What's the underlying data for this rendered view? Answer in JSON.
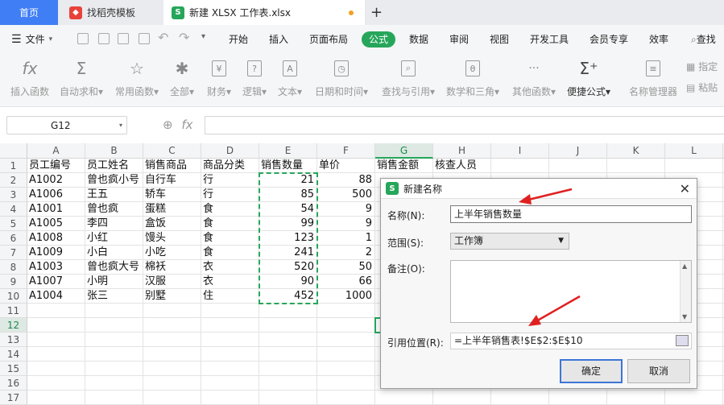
{
  "tabs": {
    "home": "首页",
    "template": "找稻壳模板",
    "file": "新建 XLSX 工作表.xlsx",
    "add": "+"
  },
  "menu": {
    "file": "文件",
    "items": [
      "开始",
      "插入",
      "页面布局",
      "公式",
      "数据",
      "审阅",
      "视图",
      "开发工具",
      "会员专享",
      "效率"
    ],
    "active": "公式",
    "search": "查找"
  },
  "ribbon": {
    "buttons": [
      "插入函数",
      "自动求和",
      "常用函数",
      "全部",
      "财务",
      "逻辑",
      "文本",
      "日期和时间",
      "查找与引用",
      "数学和三角",
      "其他函数",
      "便捷公式",
      "名称管理器"
    ],
    "right_top": "指定",
    "right_bottom": "粘贴"
  },
  "formula_bar": {
    "cell_ref": "G12",
    "fx": "fx",
    "content": ""
  },
  "grid": {
    "columns": [
      "A",
      "B",
      "C",
      "D",
      "E",
      "F",
      "G",
      "H",
      "I",
      "J",
      "K",
      "L"
    ],
    "rows": [
      "1",
      "2",
      "3",
      "4",
      "5",
      "6",
      "7",
      "8",
      "9",
      "10",
      "11",
      "12",
      "13",
      "14",
      "15",
      "16",
      "17"
    ],
    "header": [
      "员工编号",
      "员工姓名",
      "销售商品",
      "商品分类",
      "销售数量",
      "单价",
      "销售金额",
      "核查人员"
    ],
    "data": [
      [
        "A1002",
        "曾也疯小号",
        "自行车",
        "行",
        "21",
        "88"
      ],
      [
        "A1006",
        "王五",
        "轿车",
        "行",
        "85",
        "500"
      ],
      [
        "A1001",
        "曾也疯",
        "蛋糕",
        "食",
        "54",
        "9"
      ],
      [
        "A1005",
        "李四",
        "盒饭",
        "食",
        "99",
        "9"
      ],
      [
        "A1008",
        "小红",
        "馒头",
        "食",
        "123",
        "1"
      ],
      [
        "A1009",
        "小白",
        "小吃",
        "食",
        "241",
        "2"
      ],
      [
        "A1003",
        "曾也疯大号",
        "棉袄",
        "衣",
        "520",
        "50"
      ],
      [
        "A1007",
        "小明",
        "汉服",
        "衣",
        "90",
        "66"
      ],
      [
        "A1004",
        "张三",
        "别墅",
        "住",
        "452",
        "1000"
      ]
    ]
  },
  "dialog": {
    "title": "新建名称",
    "name_label": "名称(N):",
    "name_value": "上半年销售数量",
    "scope_label": "范围(S):",
    "scope_value": "工作簿",
    "comment_label": "备注(O):",
    "ref_label": "引用位置(R):",
    "ref_value": "=上半年销售表!$E$2:$E$10",
    "ok": "确定",
    "cancel": "取消"
  },
  "colors": {
    "accent": "#26a65b",
    "tab_blue": "#3f7ef5",
    "arrow_red": "#e02020"
  }
}
